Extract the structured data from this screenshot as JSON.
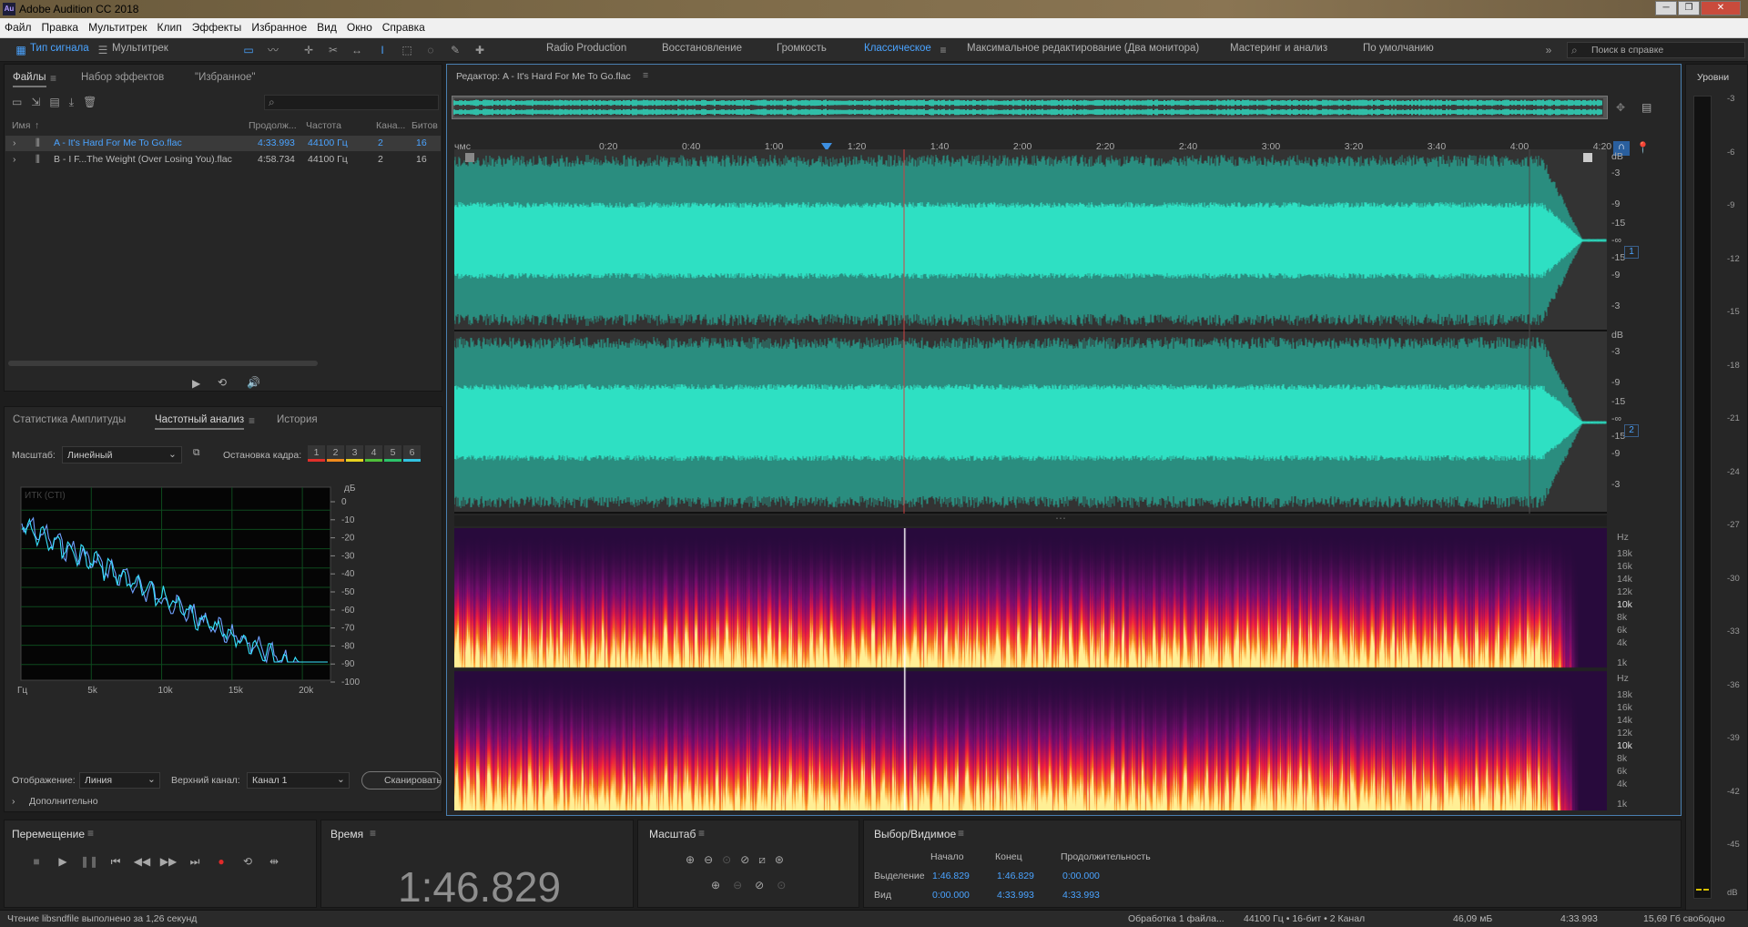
{
  "window": {
    "title": "Adobe Audition CC 2018",
    "app_icon": "Au"
  },
  "menu": [
    "Файл",
    "Правка",
    "Мультитрек",
    "Клип",
    "Эффекты",
    "Избранное",
    "Вид",
    "Окно",
    "Справка"
  ],
  "toolbar": {
    "waveform_label": "Тип сигнала",
    "multitrack_label": "Мультитрек",
    "workspaces": [
      "Radio Production",
      "Восстановление",
      "Громкость",
      "Классическое",
      "Максимальное редактирование (Два монитора)",
      "Мастеринг и анализ",
      "По умолчанию"
    ],
    "active_workspace": "Классическое",
    "search_placeholder": "Поиск в справке"
  },
  "files_panel": {
    "tabs": [
      "Файлы",
      "Набор эффектов",
      "\"Избранное\""
    ],
    "columns": [
      "Имя",
      "Продолж...",
      "Частота",
      "Кана...",
      "Битов"
    ],
    "rows": [
      {
        "name": "A - It's Hard For Me To Go.flac",
        "duration": "4:33.993",
        "rate": "44100 Гц",
        "channels": "2",
        "bits": "16",
        "selected": true
      },
      {
        "name": "B - I F...The Weight (Over Losing You).flac",
        "duration": "4:58.734",
        "rate": "44100 Гц",
        "channels": "2",
        "bits": "16",
        "selected": false
      }
    ]
  },
  "analysis_panel": {
    "tabs": [
      "Статистика Амплитуды",
      "Частотный анализ",
      "История"
    ],
    "scale_label": "Масштаб:",
    "scale_value": "Линейный",
    "freeze_label": "Остановка кадра:",
    "freeze_buttons": [
      "1",
      "2",
      "3",
      "4",
      "5",
      "6"
    ],
    "freeze_colors": [
      "#e0302a",
      "#f08a1c",
      "#e8d21f",
      "#4fbf3a",
      "#2cc36a",
      "#32c2e0"
    ],
    "plot_label": "ИТК (CTI)",
    "db_label": "дБ",
    "db_ticks": [
      "0",
      "-10",
      "-20",
      "-30",
      "-40",
      "-50",
      "-60",
      "-70",
      "-80",
      "-90",
      "-100"
    ],
    "freq_ticks": [
      "Гц",
      "5k",
      "10k",
      "15k",
      "20k"
    ],
    "display_label": "Отображение:",
    "display_value": "Линия",
    "channel_label": "Верхний канал:",
    "channel_value": "Канал 1",
    "scan_button": "Сканировать",
    "more_label": "Дополнительно"
  },
  "editor": {
    "title": "Редактор: A - It's Hard For Me To Go.flac",
    "time_unit": "чмс",
    "ruler": [
      "0:20",
      "0:40",
      "1:00",
      "1:20",
      "1:40",
      "2:00",
      "2:20",
      "2:40",
      "3:00",
      "3:20",
      "3:40",
      "4:00",
      "4:20"
    ],
    "db_scale_top": [
      "dB",
      "-3",
      "-9",
      "-15",
      "-∞",
      "-15",
      "-9",
      "-3"
    ],
    "db_scale_bottom": [
      "dB",
      "-3",
      "-9",
      "-15",
      "-∞",
      "-15",
      "-9",
      "-3"
    ],
    "channel_1": "1",
    "channel_2": "2",
    "hz_scale": [
      "Hz",
      "18k",
      "16k",
      "14k",
      "12k",
      "10k",
      "8k",
      "6k",
      "4k",
      "1k"
    ],
    "waveform_color": "#2ee0c3",
    "playhead_position_label": "1:46.829"
  },
  "levels_panel": {
    "title": "Уровни",
    "ticks": [
      "-3",
      "-6",
      "-9",
      "-12",
      "-15",
      "-18",
      "-21",
      "-24",
      "-27",
      "-30",
      "-33",
      "-36",
      "-39",
      "-42",
      "-45",
      "dB"
    ]
  },
  "transport": {
    "title": "Перемещение"
  },
  "time_panel": {
    "title": "Время",
    "value": "1:46.829"
  },
  "zoom_panel": {
    "title": "Масштаб"
  },
  "selection_panel": {
    "title": "Выбор/Видимое",
    "col_start": "Начало",
    "col_end": "Конец",
    "col_duration": "Продолжительность",
    "row_selection": "Выделение",
    "row_view": "Вид",
    "sel_start": "1:46.829",
    "sel_end": "1:46.829",
    "sel_duration": "0:00.000",
    "view_start": "0:00.000",
    "view_end": "4:33.993",
    "view_duration": "4:33.993"
  },
  "status": {
    "left": "Чтение libsndfile выполнено за 1,26 секунд",
    "processing": "Обработка 1 файла...",
    "format": "44100 Гц • 16-бит • 2 Канал",
    "size": "46,09 мБ",
    "duration": "4:33.993",
    "free": "15,69 Гб свободно"
  }
}
